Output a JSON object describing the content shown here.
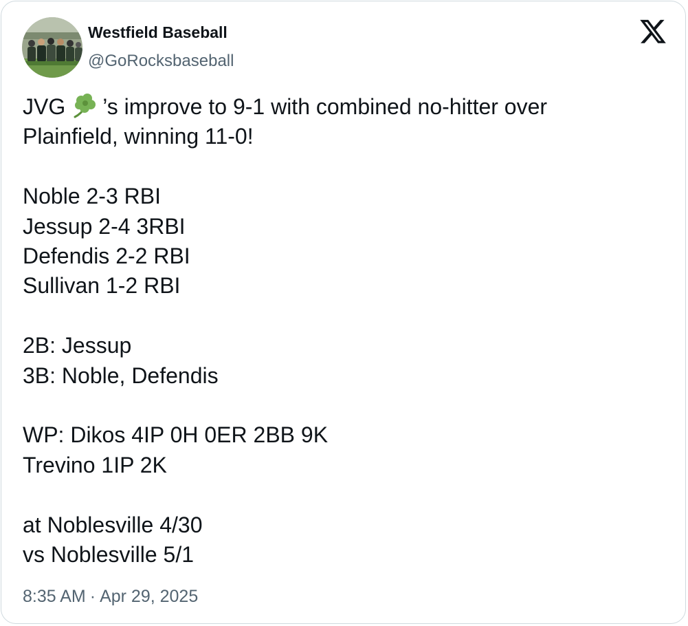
{
  "author": {
    "display_name": "Westfield Baseball",
    "handle": "@GoRocksbaseball"
  },
  "platform_icon": "x-logo-icon",
  "tweet": {
    "line1_before_emoji": "JVG",
    "emoji": "shamrock-icon",
    "line1_after_emoji": "’s improve to 9-1 with combined no-hitter over",
    "line2": "Plainfield, winning 11-0!",
    "batting": [
      "Noble 2-3 RBI",
      "Jessup 2-4 3RBI",
      "Defendis 2-2 RBI",
      "Sullivan 1-2 RBI"
    ],
    "extra_base_hits": [
      "2B: Jessup",
      "3B: Noble, Defendis"
    ],
    "pitching": [
      "WP: Dikos 4IP 0H 0ER 2BB 9K",
      "Trevino 1IP 2K"
    ],
    "schedule": [
      "at Noblesville 4/30",
      "vs Noblesville 5/1"
    ]
  },
  "meta": {
    "time": "8:35 AM",
    "separator": "·",
    "date": "Apr 29, 2025"
  },
  "colors": {
    "text_primary": "#0f1419",
    "text_secondary": "#536471",
    "border": "#cfd9de",
    "shamrock": "#77b255"
  }
}
